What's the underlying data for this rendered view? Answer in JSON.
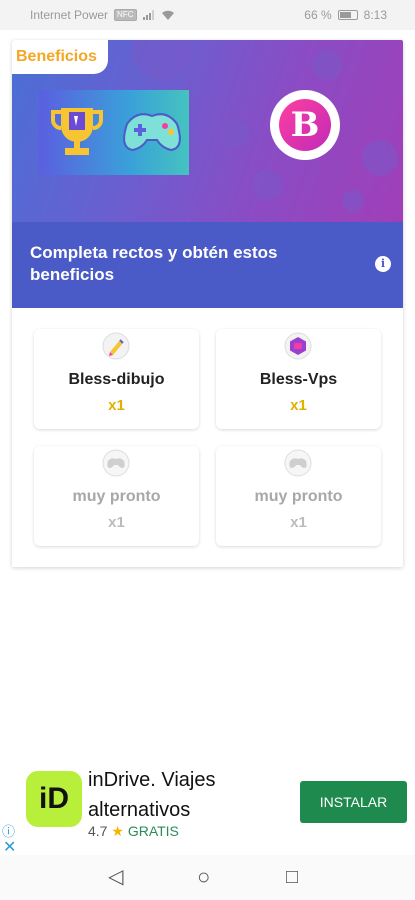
{
  "status_bar": {
    "carrier": "Internet Power",
    "nfc_badge": "NFC",
    "battery": "66 %",
    "time": "8:13",
    "icons": [
      "signal-icon",
      "wifi-icon",
      "battery-icon"
    ]
  },
  "banner": {
    "tag": "Beneficios",
    "logo_letter": "B"
  },
  "headline": {
    "text": "Completa rectos y obtén estos beneficios",
    "info_icon": "i"
  },
  "benefits": [
    {
      "name": "Bless-dibujo",
      "qty": "x1",
      "icon": "pencil-icon",
      "active": true
    },
    {
      "name": "Bless-Vps",
      "qty": "x1",
      "icon": "server-icon",
      "active": true
    },
    {
      "name": "muy pronto",
      "qty": "x1",
      "icon": "gamepad-icon",
      "active": false
    },
    {
      "name": "muy pronto",
      "qty": "x1",
      "icon": "gamepad-icon",
      "active": false
    }
  ],
  "ad": {
    "logo_text": "iD",
    "title": "inDrive. Viajes alternativos",
    "rating": "4.7",
    "star": "★",
    "price": "GRATIS",
    "cta": "INSTALAR",
    "info": "ⓘ",
    "close": "✕"
  },
  "nav": {
    "back": "◁",
    "home": "○",
    "recents": "□"
  },
  "colors": {
    "headline_bg": "#4a5bc7",
    "tag_text": "#f5a623",
    "qty_active": "#e2b100",
    "ad_button": "#1e8a4e"
  }
}
